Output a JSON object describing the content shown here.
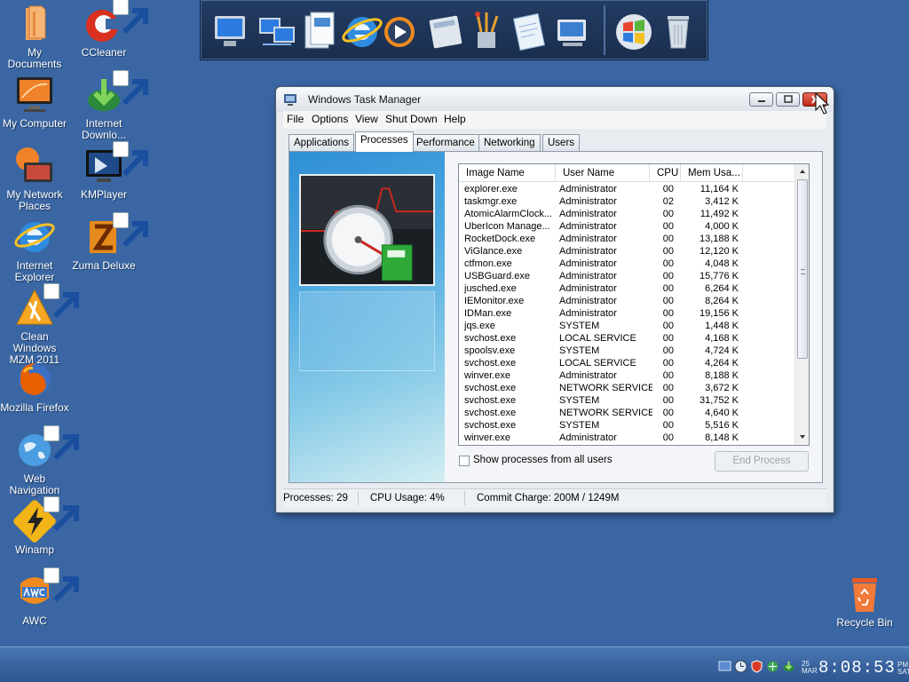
{
  "desktop": {
    "icons": [
      {
        "label": "My Documents",
        "icon": "folder-documents-icon"
      },
      {
        "label": "CCleaner",
        "icon": "ccleaner-icon"
      },
      {
        "label": "My Computer",
        "icon": "computer-monitor-icon"
      },
      {
        "label": "Internet Downlo...",
        "icon": "internet-download-manager-icon"
      },
      {
        "label": "My Network Places",
        "icon": "network-places-icon"
      },
      {
        "label": "KMPlayer",
        "icon": "kmplayer-icon"
      },
      {
        "label": "Internet Explorer",
        "icon": "internet-explorer-icon"
      },
      {
        "label": "Zuma Deluxe",
        "icon": "zuma-deluxe-icon"
      },
      {
        "label": "Clean Windows MZM 2011",
        "icon": "clean-windows-icon"
      },
      {
        "label": "Mozilla Firefox",
        "icon": "firefox-icon"
      },
      {
        "label": "Web Navigation",
        "icon": "web-navigation-globe-icon"
      },
      {
        "label": "Winamp",
        "icon": "winamp-icon"
      },
      {
        "label": "AWC",
        "icon": "awc-icon"
      },
      {
        "label": "Recycle Bin",
        "icon": "recycle-bin-icon"
      }
    ]
  },
  "dock": {
    "items": [
      "my-computer-icon",
      "network-icon",
      "documents-icon",
      "internet-explorer-icon",
      "media-player-icon",
      "calculator-icon",
      "paint-brushes-icon",
      "notepad-icon",
      "control-panel-icon",
      "windows-logo-icon",
      "recycle-bin-icon"
    ]
  },
  "window": {
    "title": "Windows Task Manager",
    "menu": [
      "File",
      "Options",
      "View",
      "Shut Down",
      "Help"
    ],
    "tabs": [
      "Applications",
      "Processes",
      "Performance",
      "Networking",
      "Users"
    ],
    "active_tab": "Processes",
    "columns": [
      "Image Name",
      "User Name",
      "CPU",
      "Mem Usa..."
    ],
    "processes": [
      {
        "name": "explorer.exe",
        "user": "Administrator",
        "cpu": "00",
        "mem": "11,164 K"
      },
      {
        "name": "taskmgr.exe",
        "user": "Administrator",
        "cpu": "02",
        "mem": "3,412 K"
      },
      {
        "name": "AtomicAlarmClock...",
        "user": "Administrator",
        "cpu": "00",
        "mem": "11,492 K"
      },
      {
        "name": "UberIcon Manage...",
        "user": "Administrator",
        "cpu": "00",
        "mem": "4,000 K"
      },
      {
        "name": "RocketDock.exe",
        "user": "Administrator",
        "cpu": "00",
        "mem": "13,188 K"
      },
      {
        "name": "ViGlance.exe",
        "user": "Administrator",
        "cpu": "00",
        "mem": "12,120 K"
      },
      {
        "name": "ctfmon.exe",
        "user": "Administrator",
        "cpu": "00",
        "mem": "4,048 K"
      },
      {
        "name": "USBGuard.exe",
        "user": "Administrator",
        "cpu": "00",
        "mem": "15,776 K"
      },
      {
        "name": "jusched.exe",
        "user": "Administrator",
        "cpu": "00",
        "mem": "6,264 K"
      },
      {
        "name": "IEMonitor.exe",
        "user": "Administrator",
        "cpu": "00",
        "mem": "8,264 K"
      },
      {
        "name": "IDMan.exe",
        "user": "Administrator",
        "cpu": "00",
        "mem": "19,156 K"
      },
      {
        "name": "jqs.exe",
        "user": "SYSTEM",
        "cpu": "00",
        "mem": "1,448 K"
      },
      {
        "name": "svchost.exe",
        "user": "LOCAL SERVICE",
        "cpu": "00",
        "mem": "4,168 K"
      },
      {
        "name": "spoolsv.exe",
        "user": "SYSTEM",
        "cpu": "00",
        "mem": "4,724 K"
      },
      {
        "name": "svchost.exe",
        "user": "LOCAL SERVICE",
        "cpu": "00",
        "mem": "4,264 K"
      },
      {
        "name": "winver.exe",
        "user": "Administrator",
        "cpu": "00",
        "mem": "8,188 K"
      },
      {
        "name": "svchost.exe",
        "user": "NETWORK SERVICE",
        "cpu": "00",
        "mem": "3,672 K"
      },
      {
        "name": "svchost.exe",
        "user": "SYSTEM",
        "cpu": "00",
        "mem": "31,752 K"
      },
      {
        "name": "svchost.exe",
        "user": "NETWORK SERVICE",
        "cpu": "00",
        "mem": "4,640 K"
      },
      {
        "name": "svchost.exe",
        "user": "SYSTEM",
        "cpu": "00",
        "mem": "5,516 K"
      },
      {
        "name": "winver.exe",
        "user": "Administrator",
        "cpu": "00",
        "mem": "8,148 K"
      }
    ],
    "show_all_label": "Show processes from all users",
    "show_all_checked": false,
    "end_process_label": "End Process",
    "status": {
      "processes": "Processes: 29",
      "cpu": "CPU Usage: 4%",
      "commit": "Commit Charge: 200M / 1249M"
    }
  },
  "taskbar": {
    "date_day": "25",
    "date_month": "MAR",
    "time": "8:08:53",
    "am_pm": "PM",
    "weekday": "SAT"
  },
  "colors": {
    "desktop": "#3a67a3",
    "close_button": "#c02814"
  }
}
